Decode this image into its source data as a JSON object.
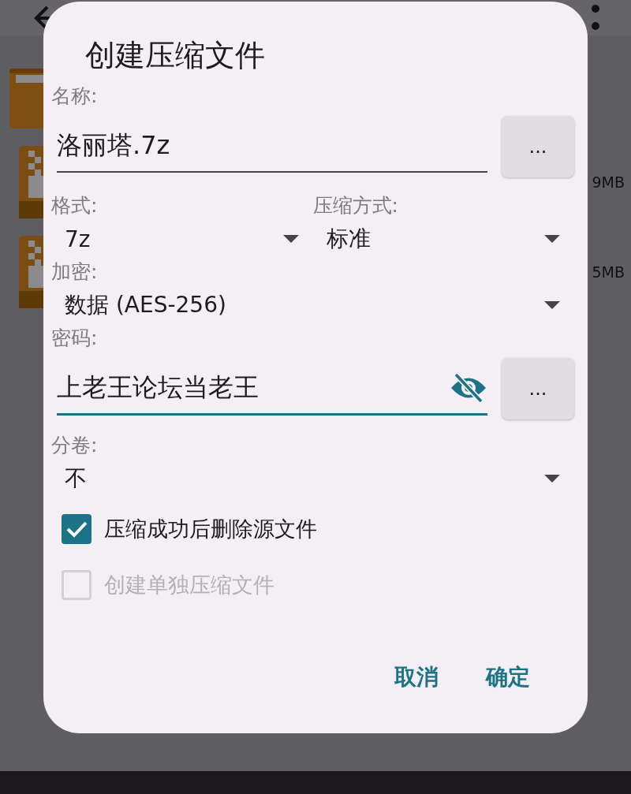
{
  "background": {
    "file_sizes": [
      "9MB",
      "5MB"
    ]
  },
  "dialog": {
    "title": "创建压缩文件",
    "name": {
      "label": "名称:",
      "value": "洛丽塔.7z",
      "focused": false,
      "button": "..."
    },
    "selects": [
      {
        "label": "格式:",
        "value": "7z"
      },
      {
        "label": "压缩方式:",
        "value": "标准"
      }
    ],
    "encryption": {
      "label": "加密:",
      "value": "数据 (AES-256)"
    },
    "password": {
      "label": "密码:",
      "value": "上老王论坛当老王",
      "focused": true,
      "button": "..."
    },
    "split": {
      "label": "分卷:",
      "value": "不"
    },
    "options": [
      {
        "label": "压缩成功后删除源文件",
        "checked": true,
        "disabled": false
      },
      {
        "label": "创建单独压缩文件",
        "checked": false,
        "disabled": true
      }
    ],
    "buttons": [
      "取消",
      "确定"
    ]
  }
}
